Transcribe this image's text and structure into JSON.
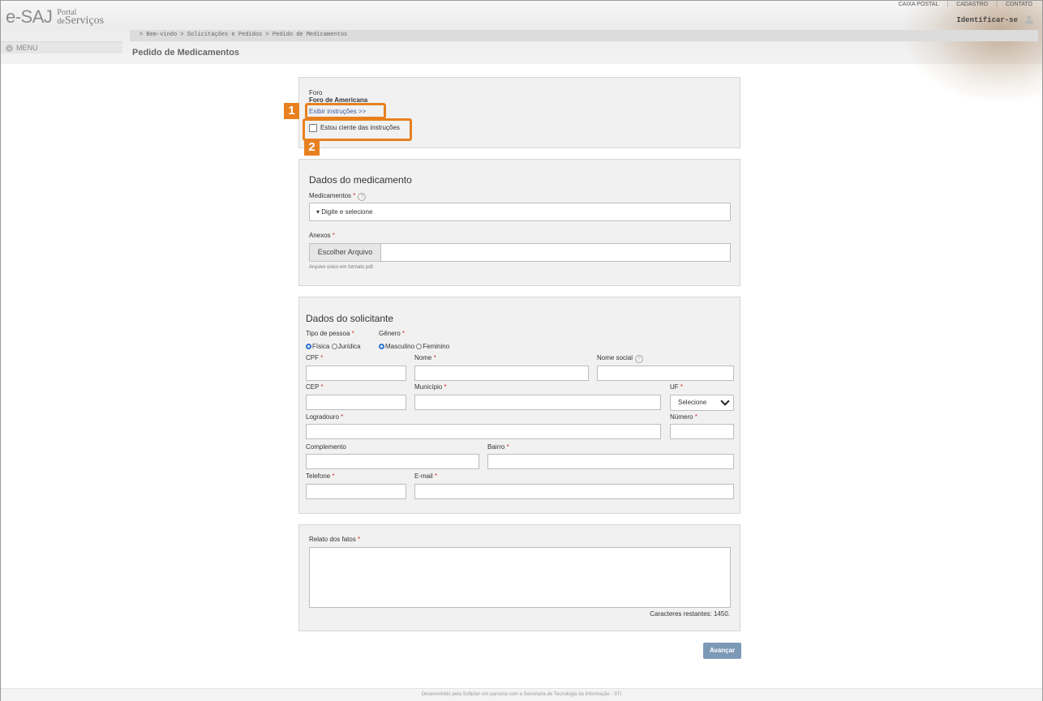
{
  "header": {
    "logo_text": "e-SAJ",
    "portal_small": "Portal",
    "portal_de": "de",
    "portal_big": "Serviços",
    "top_links": [
      "CAIXA POSTAL",
      "CADASTRO",
      "CONTATO"
    ],
    "identify_label": "Identificar-se",
    "menu_label": "MENU",
    "breadcrumb": "> Bem-vindo > Solicitações e Pedidos > Pedido de Medicamentos",
    "page_title": "Pedido de Medicamentos"
  },
  "foro_panel": {
    "label": "Foro",
    "value": "Foro de Americana",
    "show_instructions": "Exibir instruções >>",
    "agree_label": "Estou ciente das instruções",
    "agree_checked": false
  },
  "annotations": {
    "one": "1",
    "two": "2",
    "color": "#e8801f"
  },
  "medicamento": {
    "title": "Dados do medicamento",
    "med_label": "Medicamentos",
    "med_placeholder": "Digite e selecione",
    "anexos_label": "Anexos",
    "file_button": "Escolher Arquivo",
    "file_hint": "Arquivo único em formato pdf."
  },
  "solicitante": {
    "title": "Dados do solicitante",
    "tipo_label": "Tipo de pessoa",
    "tipo_options": [
      "Física",
      "Jurídica"
    ],
    "genero_label": "Gênero",
    "genero_options": [
      "Masculino",
      "Feminino"
    ],
    "cpf": "CPF",
    "nome": "Nome",
    "nome_social": "Nome social",
    "cep": "CEP",
    "municipio": "Município",
    "uf": "UF",
    "uf_selected": "Selecione",
    "logradouro": "Logradouro",
    "numero": "Número",
    "complemento": "Complemento",
    "bairro": "Bairro",
    "telefone": "Telefone",
    "email": "E-mail"
  },
  "relato": {
    "label": "Relato dos fatos",
    "remaining": "Caracteres restantes: 1450."
  },
  "submit_label": "Avançar",
  "required_mark": "*",
  "help_mark": "?",
  "footer": "Desenvolvido pela Softplan em parceria com a Secretaria de Tecnologia da Informação - STI"
}
